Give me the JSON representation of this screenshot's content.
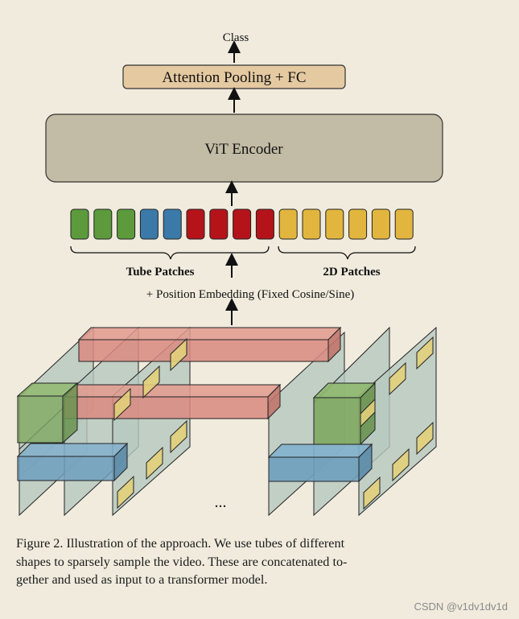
{
  "labels": {
    "class": "Class",
    "pooling": "Attention Pooling + FC",
    "encoder": "ViT Encoder",
    "tube_patches": "Tube Patches",
    "patches_2d": "2D Patches",
    "position_embedding": "+ Position Embedding (Fixed Cosine/Sine)",
    "ellipsis": "..."
  },
  "tokens": [
    {
      "group": "tube",
      "color": "#5c9a3c"
    },
    {
      "group": "tube",
      "color": "#5c9a3c"
    },
    {
      "group": "tube",
      "color": "#5c9a3c"
    },
    {
      "group": "tube",
      "color": "#3b7aa8"
    },
    {
      "group": "tube",
      "color": "#3b7aa8"
    },
    {
      "group": "tube",
      "color": "#b5131a"
    },
    {
      "group": "tube",
      "color": "#b5131a"
    },
    {
      "group": "tube",
      "color": "#b5131a"
    },
    {
      "group": "tube",
      "color": "#b5131a"
    },
    {
      "group": "2d",
      "color": "#e2b63e"
    },
    {
      "group": "2d",
      "color": "#e2b63e"
    },
    {
      "group": "2d",
      "color": "#e2b63e"
    },
    {
      "group": "2d",
      "color": "#e2b63e"
    },
    {
      "group": "2d",
      "color": "#e2b63e"
    },
    {
      "group": "2d",
      "color": "#e2b63e"
    }
  ],
  "caption": {
    "line1": "Figure 2.  Illustration of the approach.  We use tubes of different",
    "line2": "shapes to sparsely sample the video.  These are concatenated to-",
    "line3": "gether and used as input to a transformer model."
  },
  "watermark": "CSDN @v1dv1dv1d",
  "colors": {
    "background": "#f0ebdd",
    "pooling_fill": "#e5c9a1",
    "encoder_fill": "#c2bba5",
    "frame_fill": "#b6c8bf",
    "red_tube": "#d98a80",
    "green_tube": "#7fa860",
    "blue_tube": "#6e9fbe",
    "yellow_patch": "#e2cf7a"
  }
}
